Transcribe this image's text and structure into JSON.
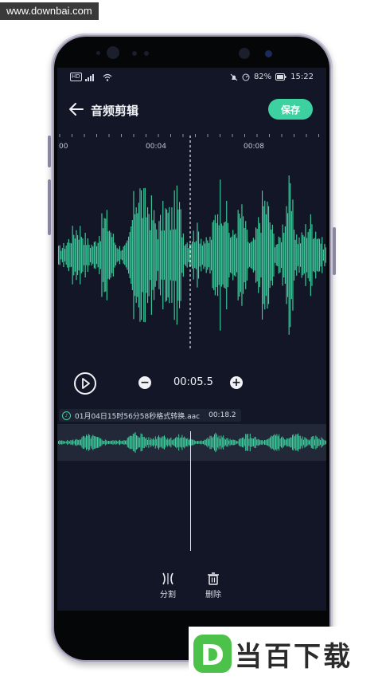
{
  "watermark": {
    "site": "www.downbai.com"
  },
  "status_bar": {
    "battery": "82%",
    "time": "15:22",
    "left_badge": "HD"
  },
  "header": {
    "title": "音频剪辑",
    "save_label": "保存"
  },
  "timeline": {
    "labels": [
      "00",
      "00:04",
      "00:08"
    ]
  },
  "controls": {
    "position": "00:05.5",
    "minus": "−",
    "plus": "+"
  },
  "file": {
    "name": "01月04日15时56分58秒格式转换.aac",
    "duration": "00:18.2"
  },
  "tools": [
    {
      "label": "分割",
      "icon": "split-icon"
    },
    {
      "label": "删除",
      "icon": "trash-icon"
    }
  ],
  "logo": {
    "text": "当百下载",
    "mark": "D"
  },
  "colors": {
    "accent": "#3ed1a0",
    "screen_bg": "#121627",
    "strip_bg": "#232838"
  }
}
